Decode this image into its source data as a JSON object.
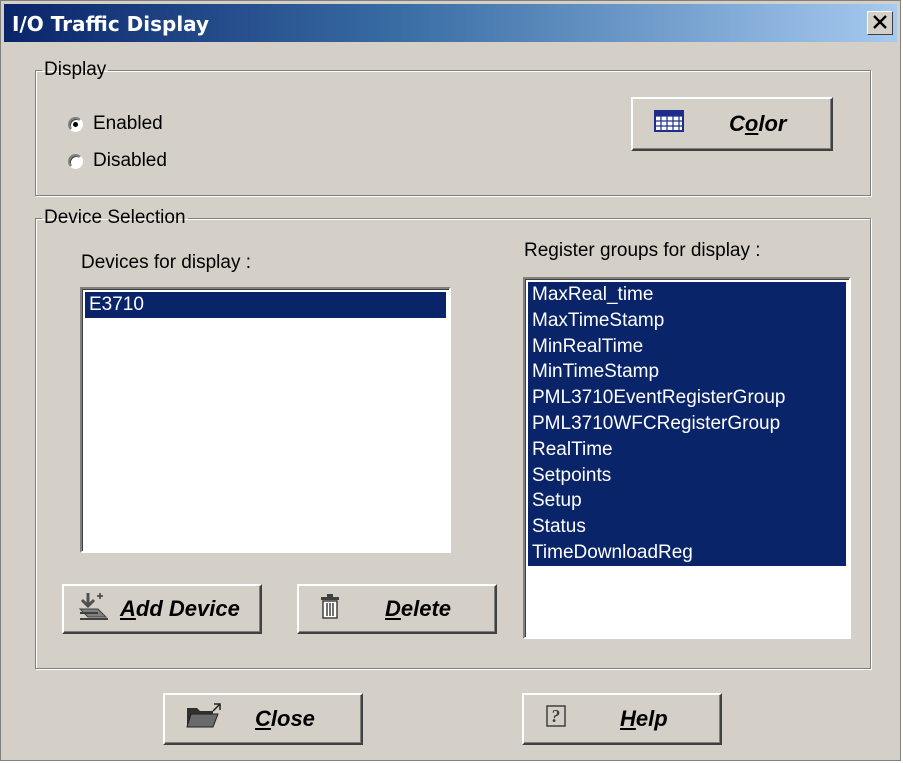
{
  "window": {
    "title": "I/O Traffic Display",
    "close_glyph": "✕"
  },
  "display_group": {
    "legend": "Display",
    "enabled_label": "Enabled",
    "disabled_label": "Disabled",
    "selected": "Enabled",
    "color_button": {
      "label": "Color",
      "mnemonic": "o",
      "icon": "grid-palette-icon"
    }
  },
  "device_group": {
    "legend": "Device Selection",
    "devices_label": "Devices for display :",
    "devices": [
      "E3710"
    ],
    "selected_devices": [
      "E3710"
    ],
    "registers_label": "Register groups for display :",
    "registers": [
      "MaxReal_time",
      "MaxTimeStamp",
      "MinRealTime",
      "MinTimeStamp",
      "PML3710EventRegisterGroup",
      "PML3710WFCRegisterGroup",
      "RealTime",
      "Setpoints",
      "Setup",
      "Status",
      "TimeDownloadReg"
    ],
    "add_button": {
      "label": "Add Device",
      "icon": "add-device-icon"
    },
    "delete_button": {
      "label": "Delete",
      "icon": "trash-icon"
    }
  },
  "footer": {
    "close_button": {
      "label": "Close",
      "icon": "folder-icon"
    },
    "help_button": {
      "label": "Help",
      "icon": "help-icon"
    }
  },
  "colors": {
    "title_start": "#0a246a",
    "title_end": "#a6caf0",
    "face": "#d4d0c8",
    "selection": "#0a246a"
  }
}
